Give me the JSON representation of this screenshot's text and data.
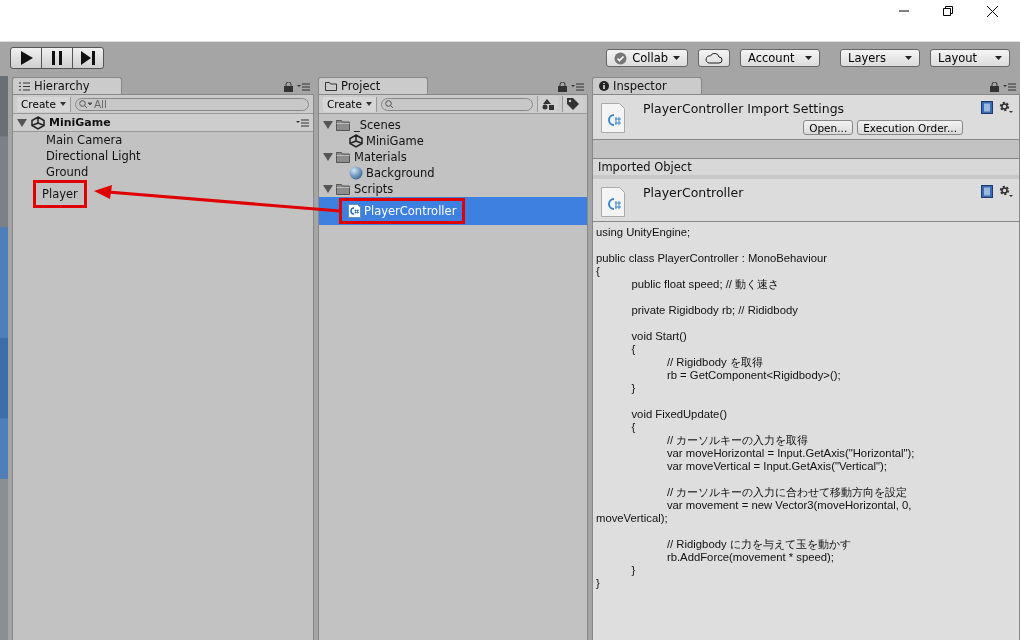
{
  "toolbar": {
    "collab": "Collab",
    "account": "Account",
    "layers": "Layers",
    "layout": "Layout"
  },
  "hierarchy": {
    "title": "Hierarchy",
    "create": "Create",
    "search": {
      "placeholder": "All"
    },
    "scene": {
      "name": "MiniGame",
      "expanded": true,
      "children": [
        {
          "name": "Main Camera",
          "highlighted": false
        },
        {
          "name": "Directional Light",
          "highlighted": false
        },
        {
          "name": "Ground",
          "highlighted": false
        },
        {
          "name": "Player",
          "highlighted": true
        }
      ]
    }
  },
  "project": {
    "title": "Project",
    "create": "Create",
    "folders": [
      {
        "name": "_Scenes",
        "expanded": true,
        "children": [
          {
            "name": "MiniGame",
            "kind": "scene",
            "selected": false,
            "highlighted": false
          }
        ]
      },
      {
        "name": "Materials",
        "expanded": true,
        "children": [
          {
            "name": "Background",
            "kind": "material",
            "selected": false,
            "highlighted": false
          }
        ]
      },
      {
        "name": "Scripts",
        "expanded": true,
        "children": [
          {
            "name": "PlayerController",
            "kind": "script",
            "selected": true,
            "highlighted": true
          }
        ]
      }
    ]
  },
  "inspector": {
    "title": "Inspector",
    "header": "PlayerController Import Settings",
    "buttons": [
      "Open...",
      "Execution Order..."
    ],
    "section": "Imported Object",
    "object_name": "PlayerController",
    "code": "using UnityEngine;\n\npublic class PlayerController : MonoBehaviour\n{\n\tpublic float speed; // 動く速さ\n\n\tprivate Rigidbody rb; // Rididbody\n\n\tvoid Start()\n\t{\n\t\t// Rigidbody を取得\n\t\trb = GetComponent<Rigidbody>();\n\t}\n\n\tvoid FixedUpdate()\n\t{\n\t\t// カーソルキーの入力を取得\n\t\tvar moveHorizontal = Input.GetAxis(\"Horizontal\");\n\t\tvar moveVertical = Input.GetAxis(\"Vertical\");\n\n\t\t// カーソルキーの入力に合わせて移動方向を設定\n\t\tvar movement = new Vector3(moveHorizontal, 0,\nmoveVertical);\n\n\t\t// Ridigbody に力を与えて玉を動かす\n\t\trb.AddForce(movement * speed);\n\t}\n}"
  }
}
